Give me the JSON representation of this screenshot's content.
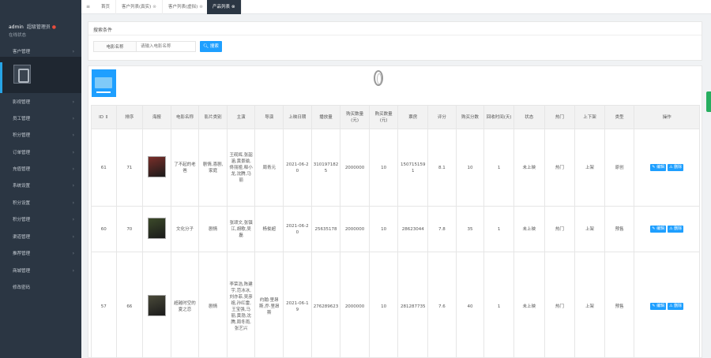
{
  "sidebar": {
    "user_name": "admin",
    "user_tag": "超级管理员",
    "role": "在线状态",
    "items": [
      {
        "label": "客户管理"
      },
      {
        "label": "影视管理"
      },
      {
        "label": "员工管理"
      },
      {
        "label": "积分管理"
      },
      {
        "label": "订单管理"
      },
      {
        "label": "充值管理"
      },
      {
        "label": "系统设置"
      },
      {
        "label": "积分设置"
      },
      {
        "label": "积分管理"
      },
      {
        "label": "渠道管理"
      },
      {
        "label": "推荐管理"
      },
      {
        "label": "商城管理"
      },
      {
        "label": "修改密码"
      }
    ]
  },
  "tabs": [
    {
      "label": "首页",
      "close": ""
    },
    {
      "label": "客户列表(真实)",
      "close": "⊗"
    },
    {
      "label": "客户列表(虚拟)",
      "close": "⊗"
    },
    {
      "label": "产品列表",
      "close": "⊗"
    }
  ],
  "search": {
    "title": "搜索条件",
    "label": "电影名称",
    "placeholder": "请输入电影名称",
    "button": "搜索"
  },
  "table": {
    "columns": [
      "ID ⇕",
      "排序",
      "海报",
      "电影名称",
      "影片类别",
      "主演",
      "导演",
      "上映日期",
      "播放量",
      "购买数量(元)",
      "购买数量(元)",
      "票房",
      "评分",
      "购买分数",
      "回收时间(天)",
      "状态",
      "热门",
      "上下架",
      "类型",
      "操作"
    ],
    "rows": [
      {
        "id": "61",
        "sort": "71",
        "name": "了不起的老爸",
        "category": "剧情,喜剧,家庭",
        "cast": "王砚辉,张韶涵,黄景瑜,佟丽娅,释小龙,沈腾,马丽",
        "director": "周青元",
        "date": "2021-06-20",
        "plays": "3101971825",
        "price": "2000000",
        "buy": "10",
        "box": "1507151591",
        "score": "8.1",
        "points": "10",
        "days": "1",
        "status": "未上映",
        "hot": "热门",
        "shelf": "上架",
        "type": "原创",
        "poster": "#7a2f2a"
      },
      {
        "id": "60",
        "sort": "70",
        "name": "文化分子",
        "category": "剧情",
        "cast": "张颂文,张镇江,胡歌,吴磊",
        "director": "杨俊超",
        "date": "2021-06-20",
        "plays": "25635178",
        "price": "2000000",
        "buy": "10",
        "box": "28623044",
        "score": "7.8",
        "points": "35",
        "days": "1",
        "status": "未上映",
        "hot": "热门",
        "shelf": "上架",
        "type": "预售",
        "poster": "#3c4a2a"
      },
      {
        "id": "57",
        "sort": "66",
        "name": "超越时空的夏之恋",
        "category": "剧情",
        "cast": "李荣浩,陈建宇,范冰冰,刘亦菲,吴彦祖,孙红雷,王宝强,马丽,黄渤,沈腾,周冬雨,张艺兴",
        "director": "约翰·里昂斯,乔·里昂斯",
        "date": "2021-06-19",
        "plays": "276289623",
        "price": "2000000",
        "buy": "10",
        "box": "281287735",
        "score": "7.6",
        "points": "40",
        "days": "1",
        "status": "未上映",
        "hot": "热门",
        "shelf": "上架",
        "type": "预售",
        "poster": "#4a4a3a"
      }
    ],
    "edit_label": "编辑",
    "delete_label": "删除"
  },
  "colors": {
    "sidebar_bg": "#2b3643",
    "accent": "#1e9fff"
  }
}
